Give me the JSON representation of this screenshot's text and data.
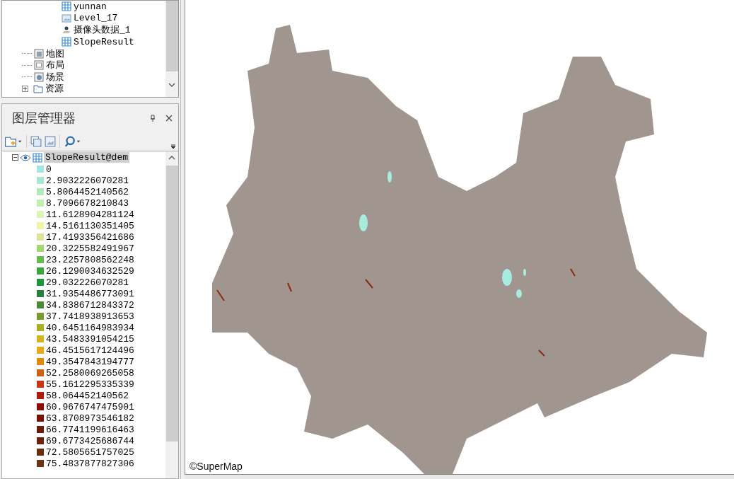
{
  "workspace_tree": {
    "datasets": [
      {
        "label": "yunnan",
        "kind": "grid"
      },
      {
        "label": "Level_17",
        "kind": "image"
      },
      {
        "label": "摄像头数据_1",
        "kind": "point"
      },
      {
        "label": "SlopeResult",
        "kind": "grid"
      }
    ],
    "nodes": [
      {
        "label": "地图",
        "kind": "map",
        "expandable": false
      },
      {
        "label": "布局",
        "kind": "layout",
        "expandable": false
      },
      {
        "label": "场景",
        "kind": "scene",
        "expandable": false
      },
      {
        "label": "资源",
        "kind": "folder",
        "expandable": true
      }
    ]
  },
  "layer_manager": {
    "title": "图层管理器",
    "layer": {
      "name": "SlopeResult@dem",
      "expanded": true,
      "visible": true,
      "selected": true
    },
    "legend": [
      {
        "label": "0",
        "color": "#a4e6e2"
      },
      {
        "label": "2.9032226070281",
        "color": "#a8e6d2"
      },
      {
        "label": "5.8064452140562",
        "color": "#b0e8c0"
      },
      {
        "label": "8.7096678210843",
        "color": "#c0f0b0"
      },
      {
        "label": "11.6128904281124",
        "color": "#daf5b8"
      },
      {
        "label": "14.5161130351405",
        "color": "#eef5a8"
      },
      {
        "label": "17.4193356421686",
        "color": "#dce49a"
      },
      {
        "label": "20.3225582491967",
        "color": "#a6d672"
      },
      {
        "label": "23.2257808562248",
        "color": "#66bb4a"
      },
      {
        "label": "26.1290034632529",
        "color": "#38a83a"
      },
      {
        "label": "29.032226070281",
        "color": "#1c963a"
      },
      {
        "label": "31.9354486773091",
        "color": "#2a7e42"
      },
      {
        "label": "34.8386712843372",
        "color": "#4a8a38"
      },
      {
        "label": "37.7418938913653",
        "color": "#7a9a30"
      },
      {
        "label": "40.6451164983934",
        "color": "#a8b028"
      },
      {
        "label": "43.5483391054215",
        "color": "#d4b420"
      },
      {
        "label": "46.4515617124496",
        "color": "#e8a818"
      },
      {
        "label": "49.3547843194777",
        "color": "#e08a10"
      },
      {
        "label": "52.2580069265058",
        "color": "#d06010"
      },
      {
        "label": "55.1612295335339",
        "color": "#c83810"
      },
      {
        "label": "58.064452140562",
        "color": "#a81c08"
      },
      {
        "label": "60.9676747475901",
        "color": "#8a0c04"
      },
      {
        "label": "63.8708973546182",
        "color": "#781004"
      },
      {
        "label": "66.7741199616463",
        "color": "#6a1808"
      },
      {
        "label": "69.6773425686744",
        "color": "#6a200c"
      },
      {
        "label": "72.5805651757025",
        "color": "#6a2c10"
      },
      {
        "label": "75.4837877827306",
        "color": "#6a3414"
      }
    ]
  },
  "map": {
    "copyright": "©SuperMap"
  }
}
